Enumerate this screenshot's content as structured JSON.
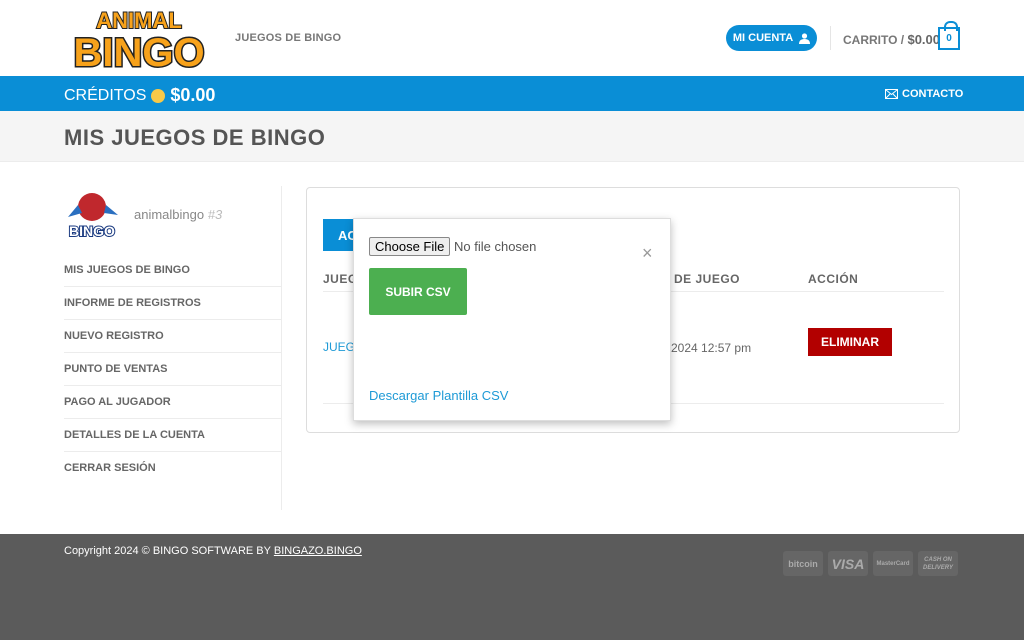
{
  "header": {
    "logo_text": "ANIMAL BINGO",
    "nav_item": "JUEGOS DE BINGO",
    "account_label": "MI CUENTA",
    "cart_label": "CARRITO /",
    "cart_total": "$0.00",
    "cart_count": "0"
  },
  "topbar": {
    "credits_label": "CRÉDITOS",
    "credits_amount": "$0.00",
    "contact_label": "CONTACTO"
  },
  "page": {
    "title": "MIS JUEGOS DE BINGO"
  },
  "user": {
    "name": "animalbingo",
    "id": "#3"
  },
  "sidebar": {
    "items": [
      {
        "label": "MIS JUEGOS DE BINGO"
      },
      {
        "label": "INFORME DE REGISTROS"
      },
      {
        "label": "NUEVO REGISTRO"
      },
      {
        "label": "PUNTO DE VENTAS"
      },
      {
        "label": "PAGO AL JUGADOR"
      },
      {
        "label": "DETALLES DE LA CUENTA"
      },
      {
        "label": "CERRAR SESIÓN"
      }
    ]
  },
  "table": {
    "add_button_partial": "AC",
    "headers": [
      "JUEG",
      "DE JUEGO",
      "ACCIÓN"
    ],
    "rows": [
      {
        "game_partial": "JUEG",
        "date_partial": "2024 12:57 pm",
        "action": "ELIMINAR"
      }
    ]
  },
  "modal": {
    "choose_file": "Choose File",
    "no_file": "No file chosen",
    "upload_label": "SUBIR CSV",
    "download_link": "Descargar Plantilla CSV",
    "close": "×"
  },
  "footer": {
    "copyright": "Copyright 2024 © BINGO SOFTWARE BY",
    "copyright_link": "BINGAZO.BINGO",
    "payments": [
      "bitcoin",
      "VISA",
      "MasterCard",
      "CASH ON DELIVERY"
    ]
  },
  "colors": {
    "primary": "#0a8ed6",
    "success": "#4caf50",
    "danger": "#b20000",
    "footer": "#5b5b5b"
  }
}
